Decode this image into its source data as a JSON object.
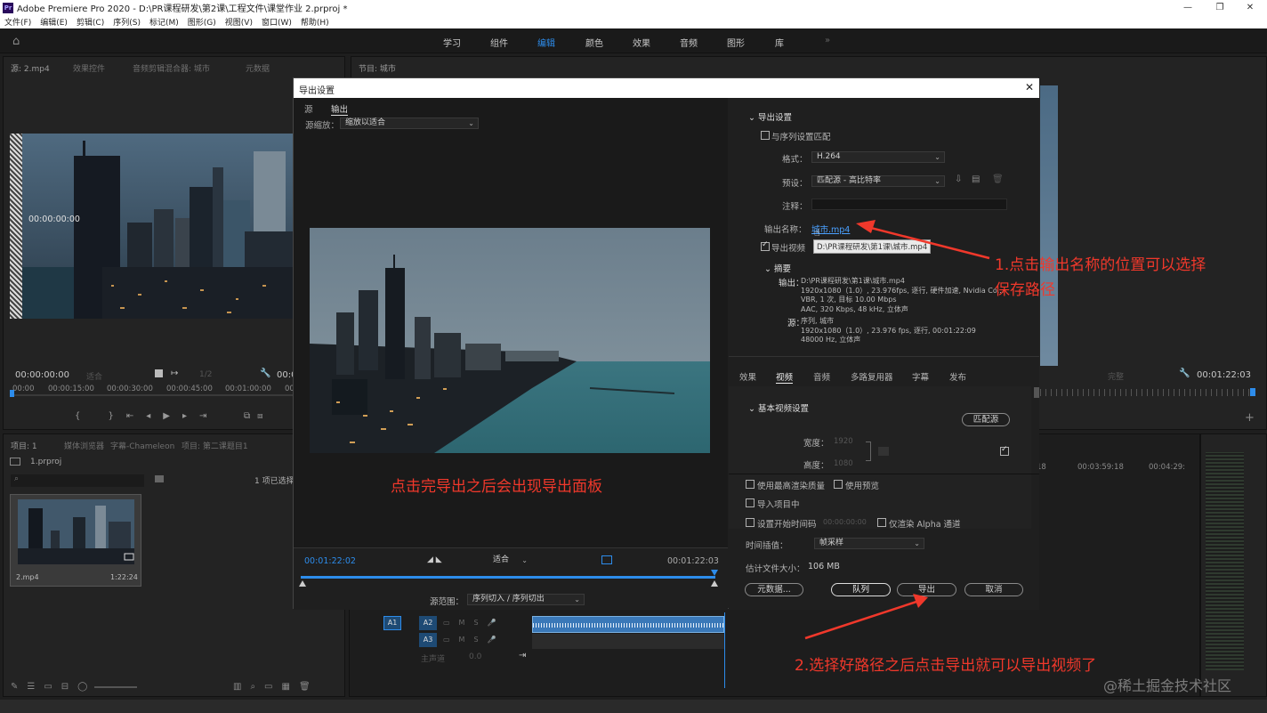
{
  "window": {
    "title": "Adobe Premiere Pro 2020 - D:\\PR课程研发\\第2课\\工程文件\\课堂作业 2.prproj *",
    "app_icon": "Pr"
  },
  "menu": [
    "文件(F)",
    "编辑(E)",
    "剪辑(C)",
    "序列(S)",
    "标记(M)",
    "图形(G)",
    "视图(V)",
    "窗口(W)",
    "帮助(H)"
  ],
  "workspaces": [
    "学习",
    "组件",
    "编辑",
    "颜色",
    "效果",
    "音频",
    "图形",
    "库"
  ],
  "workspace_more": "»",
  "source_panel": {
    "tabs": [
      "源: 2.mp4",
      "效果控件",
      "音频剪辑混合器: 城市",
      "元数据"
    ],
    "overlay_tc": "00:00:00:00",
    "timecode": "00:00:00:00",
    "fit": "适合",
    "ratio": "1/2",
    "end_tc": "00:0",
    "ruler": [
      "00:00",
      "00:00:15:00",
      "00:00:30:00",
      "00:00:45:00",
      "00:01:00:00",
      "00:0"
    ]
  },
  "program_panel": {
    "tab": "节目: 城市",
    "fit": "完整",
    "timecode": "00:01:22:03"
  },
  "project_panel": {
    "tabs": [
      "项目: 1",
      "媒体浏览器",
      "字幕-Chameleon",
      "项目: 第二课题目1"
    ],
    "file": "1.prproj",
    "selected": "1 项已选择",
    "clip_name": "2.mp4",
    "clip_duration": "1:22:24"
  },
  "timeline": {
    "ticks": [
      "18",
      "00:03:59:18",
      "00:04:29:"
    ],
    "tracks": [
      {
        "id": "A1",
        "target": "A2"
      },
      {
        "id": "",
        "target": "A3"
      }
    ],
    "master_label": "主声道",
    "master_value": "0.0"
  },
  "dialog": {
    "title": "导出设置",
    "close": "✕",
    "tabs": [
      "源",
      "输出"
    ],
    "source_scale_label": "源缩放：",
    "source_scale_value": "缩放以适合",
    "preview_annotation": "点击完导出之后会出现导出面板",
    "tc_start": "00:01:22:02",
    "tc_end": "00:01:22:03",
    "fit_value": "适合",
    "range_label": "源范围：",
    "range_value": "序列切入 / 序列切出",
    "export_settings": {
      "header": "导出设置",
      "match_sequence": "与序列设置匹配",
      "format_label": "格式：",
      "format_value": "H.264",
      "preset_label": "预设：",
      "preset_value": "匹配源 - 高比特率",
      "comment_label": "注释：",
      "output_name_label": "输出名称：",
      "output_name_value": "城市.mp4",
      "tooltip": "D:\\PR课程研发\\第1课\\城市.mp4",
      "export_video": "导出视频",
      "summary_header": "摘要",
      "summary_output_label": "输出：",
      "summary_output_lines": [
        "D:\\PR课程研发\\第1课\\城市.mp4",
        "1920x1080（1.0）, 23.976fps, 逐行, 硬件加速, Nvidia Co...",
        "VBR, 1 次, 目标 10.00 Mbps",
        "AAC, 320 Kbps, 48 kHz, 立体声"
      ],
      "summary_source_label": "源：",
      "summary_source_lines": [
        "序列, 城市",
        "1920x1080（1.0）, 23.976 fps, 逐行, 00:01:22:09",
        "48000 Hz, 立体声"
      ]
    },
    "settings_tabs": [
      "效果",
      "视频",
      "音频",
      "多路复用器",
      "字幕",
      "发布"
    ],
    "basic_video": {
      "header": "基本视频设置",
      "match_button": "匹配源",
      "width_label": "宽度：",
      "width_value": "1920",
      "height_label": "高度：",
      "height_value": "1080"
    },
    "options": {
      "max_render": "使用最高渲染质量",
      "use_previews": "使用预览",
      "import_project": "导入项目中",
      "set_start_tc": "设置开始时间码",
      "start_tc_value": "00:00:00:00",
      "alpha_only": "仅渲染 Alpha 通道",
      "interp_label": "时间插值：",
      "interp_value": "帧采样",
      "filesize_label": "估计文件大小：",
      "filesize_value": "106 MB"
    },
    "buttons": {
      "metadata": "元数据...",
      "queue": "队列",
      "export": "导出",
      "cancel": "取消"
    }
  },
  "annotations": {
    "note1_line1": "1.点击输出名称的位置可以选择",
    "note1_line2": "保存路径",
    "note2": "2.选择好路径之后点击导出就可以导出视频了",
    "watermark": "@稀土掘金技术社区"
  },
  "colors": {
    "accent_blue": "#2d8ceb",
    "annotation_red": "#f0382b",
    "link_blue": "#4aa0ff"
  }
}
